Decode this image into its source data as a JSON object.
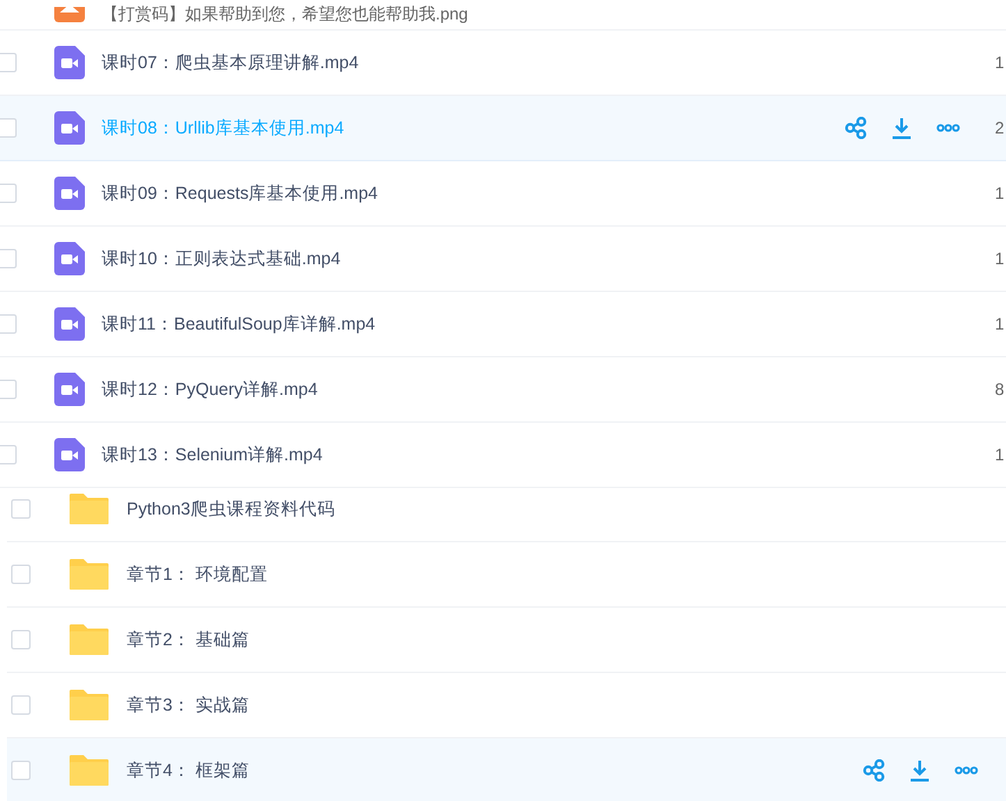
{
  "files": [
    {
      "kind": "image",
      "name": "【打赏码】如果帮助到您，希望您也能帮助我.png",
      "highlighted": false
    },
    {
      "kind": "video",
      "name": "课时07：爬虫基本原理讲解.mp4",
      "column_3": "1",
      "highlighted": false
    },
    {
      "kind": "video",
      "name": "课时08：Urllib库基本使用.mp4",
      "column_3": "2",
      "highlighted": true
    },
    {
      "kind": "video",
      "name": "课时09：Requests库基本使用.mp4",
      "column_3": "1",
      "highlighted": false
    },
    {
      "kind": "video",
      "name": "课时10：正则表达式基础.mp4",
      "column_3": "1",
      "highlighted": false
    },
    {
      "kind": "video",
      "name": "课时11：BeautifulSoup库详解.mp4",
      "column_3": "1",
      "highlighted": false
    },
    {
      "kind": "video",
      "name": "课时12：PyQuery详解.mp4",
      "column_3": "8",
      "highlighted": false
    },
    {
      "kind": "video",
      "name": "课时13：Selenium详解.mp4",
      "column_3": "1",
      "highlighted": false
    }
  ],
  "folders": [
    {
      "name": "Python3爬虫课程资料代码",
      "highlighted": false
    },
    {
      "name": "章节1： 环境配置",
      "highlighted": false
    },
    {
      "name": "章节2： 基础篇",
      "highlighted": false
    },
    {
      "name": "章节3： 实战篇",
      "highlighted": false
    },
    {
      "name": "章节4： 框架篇",
      "highlighted": true
    }
  ]
}
